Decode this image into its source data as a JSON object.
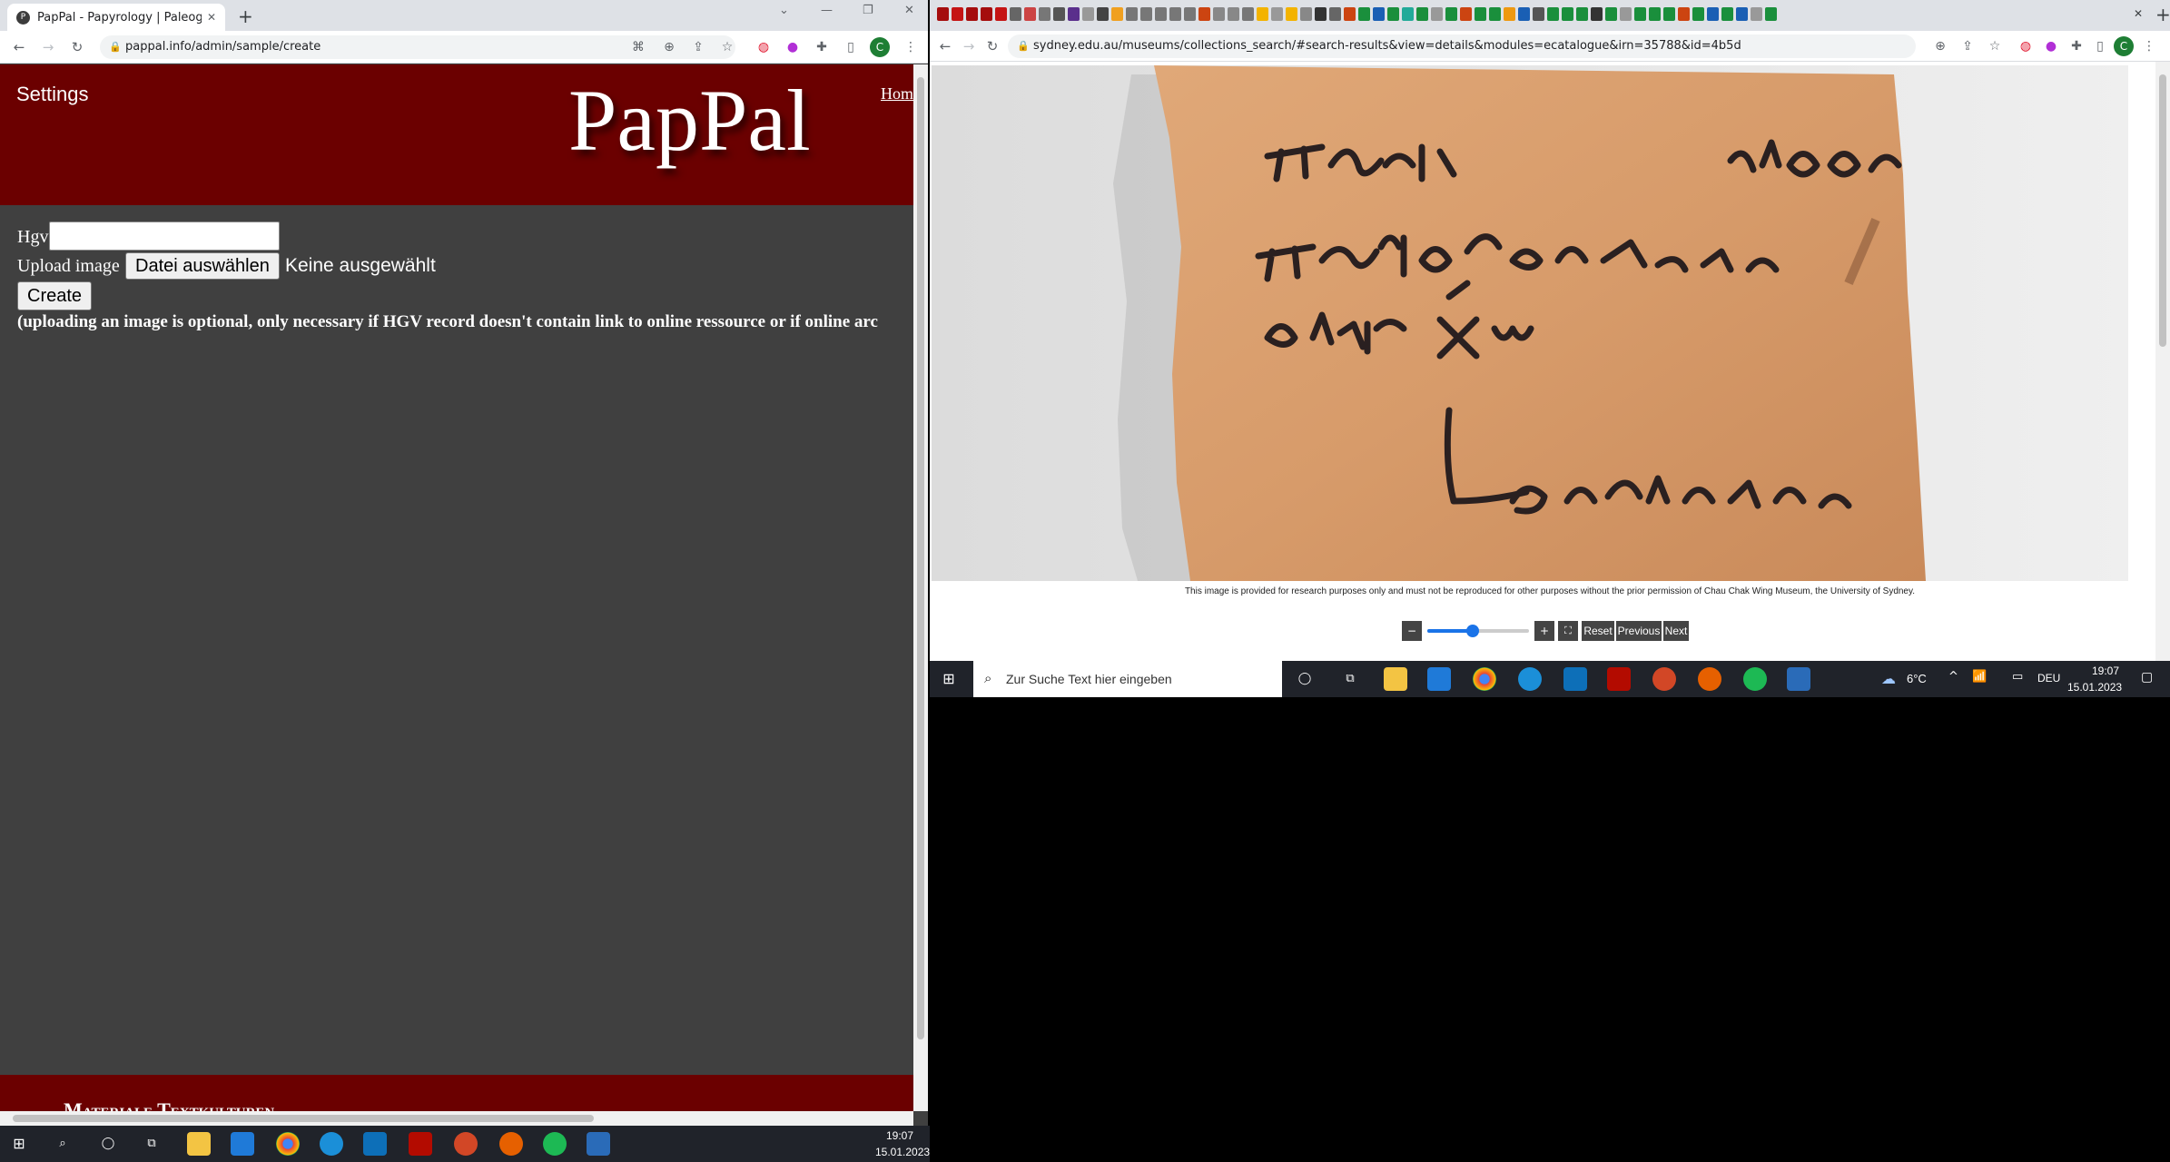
{
  "left_window": {
    "tab_title": "PapPal - Papyrology | Paleograph",
    "tab_favicon": "pappal-favicon",
    "new_tab": "+",
    "controls": [
      "⌄",
      "—",
      "❐",
      "✕"
    ],
    "url": "pappal.info/admin/sample/create",
    "nav_icons": [
      "back-icon",
      "forward-icon",
      "reload-icon"
    ],
    "toolbar_icons": [
      "translate-icon",
      "zoom-icon",
      "share-icon",
      "star-icon",
      "extension-red-icon",
      "extension-purple-icon",
      "puzzle-icon",
      "sidebar-icon",
      "profile-icon",
      "menu-icon"
    ],
    "profile_letter": "C",
    "header": {
      "settings": "Settings",
      "logo": "PapPal",
      "home_link": "Hom"
    },
    "form": {
      "hgv_label": "Hgv",
      "hgv_value": "",
      "upload_label": "Upload image",
      "file_button": "Datei auswählen",
      "file_status": "Keine ausgewählt",
      "create_button": "Create",
      "note": "(uploading an image is optional, only necessary if HGV record doesn't contain link to online ressource or if online arc"
    },
    "footer_text": "Materiale Textkulturen",
    "colors": {
      "header_bg": "#6b0000",
      "content_bg": "#404040",
      "footer_bg": "#6b0000"
    }
  },
  "right_window": {
    "url": "sydney.edu.au/museums/collections_search/#search-results&view=details&modules=ecatalogue&irn=35788&id=4b5d",
    "profile_letter": "C",
    "close_tab": "✕",
    "new_tab": "+",
    "controls": [
      "⌄",
      "—",
      "❐",
      "✕"
    ],
    "image_description": "ostracon-image",
    "copyright": "This image is provided for research purposes only and must not be reproduced for other purposes without the prior permission of Chau Chak Wing Museum, the University of Sydney.",
    "viewer": {
      "minus": "−",
      "plus": "+",
      "fit": "⛶",
      "reset": "Reset",
      "previous": "Previous",
      "next": "Next",
      "zoom_level": 0.45
    }
  },
  "right_taskbar": {
    "search_placeholder": "Zur Suche Text hier eingeben",
    "weather": "6°C",
    "lang": "DEU",
    "time": "19:07",
    "date": "15.01.2023"
  },
  "bottom_taskbar": {
    "time": "19:07",
    "date": "15.01.2023"
  }
}
